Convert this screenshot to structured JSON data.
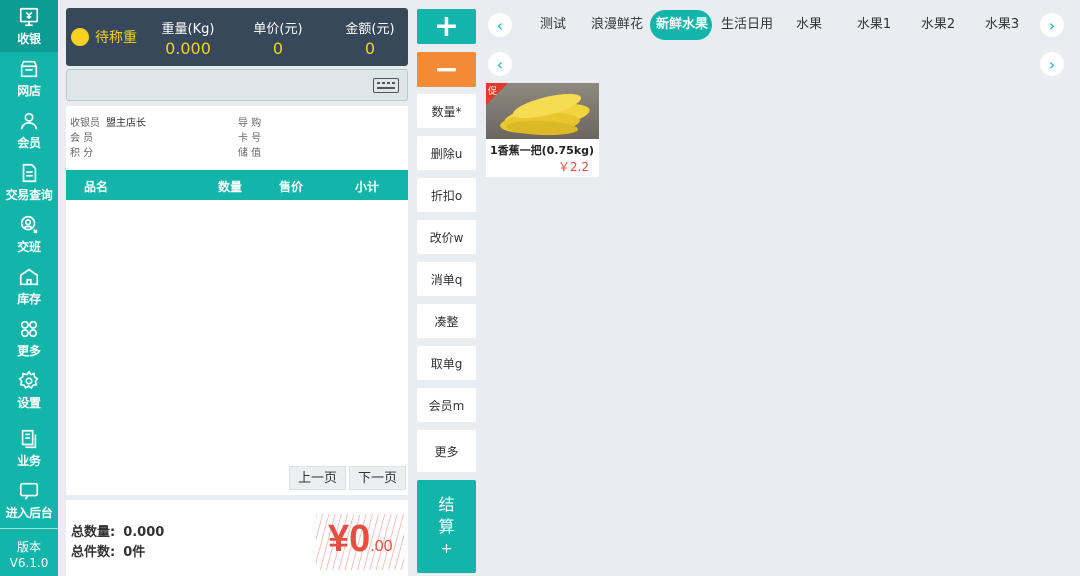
{
  "nav": {
    "items": [
      {
        "label": "收银",
        "icon": "cashier-monitor-icon"
      },
      {
        "label": "网店",
        "icon": "store-icon"
      },
      {
        "label": "会员",
        "icon": "member-icon"
      },
      {
        "label": "交易查询",
        "icon": "document-icon"
      },
      {
        "label": "交班",
        "icon": "shift-handover-icon"
      },
      {
        "label": "库存",
        "icon": "warehouse-icon"
      },
      {
        "label": "更多",
        "icon": "grid-icon"
      },
      {
        "label": "设置",
        "icon": "gear-icon"
      },
      {
        "label": "业务",
        "icon": "business-icon"
      },
      {
        "label": "进入后台",
        "icon": "chat-icon"
      }
    ],
    "version_label": "版本",
    "version": "V6.1.0"
  },
  "scale": {
    "status": "待称重",
    "weight_label": "重量(Kg)",
    "weight": "0.000",
    "unit_price_label": "单价(元)",
    "unit_price": "0",
    "amount_label": "金额(元)",
    "amount": "0"
  },
  "barcode": {
    "value": "",
    "placeholder": ""
  },
  "order_info": {
    "cashier_label": "收银员",
    "cashier": "盟主店长",
    "member_label": "会 员",
    "member": "",
    "points_label": "积 分",
    "points": "",
    "guide_label": "导 购",
    "guide": "",
    "card_label": "卡 号",
    "card": "",
    "stored_label": "储 值",
    "stored": ""
  },
  "table": {
    "headers": [
      "品名",
      "数量",
      "售价",
      "小计"
    ],
    "rows": []
  },
  "pager": {
    "prev": "上一页",
    "next": "下一页"
  },
  "totals": {
    "qty_label": "总数量:",
    "qty": "0.000",
    "count_label": "总件数:",
    "count": "0件",
    "currency": "¥",
    "amount_int": "0",
    "amount_dec": ".00"
  },
  "actions": {
    "plus": "+",
    "minus": "−",
    "buttons": [
      "数量*",
      "删除u",
      "折扣o",
      "改价w",
      "消单q",
      "凑整",
      "取单g",
      "会员m",
      "更多"
    ],
    "settle_1": "结",
    "settle_2": "算",
    "settle_3": "+"
  },
  "categories": {
    "prev_arrow": "‹",
    "next_arrow": "›",
    "tabs": [
      "测试",
      "浪漫鲜花",
      "新鲜水果",
      "生活日用",
      "水果",
      "水果1",
      "水果2",
      "水果3"
    ],
    "active_index": 2
  },
  "products": [
    {
      "name": "1香蕉一把(0.75kg)",
      "price": "￥2.2",
      "badge": "促"
    }
  ],
  "colors": {
    "primary": "#13b5aa",
    "orange": "#f28a36",
    "red": "#e54e40",
    "scale_bg": "#36485a",
    "yellow": "#f5d21b"
  }
}
